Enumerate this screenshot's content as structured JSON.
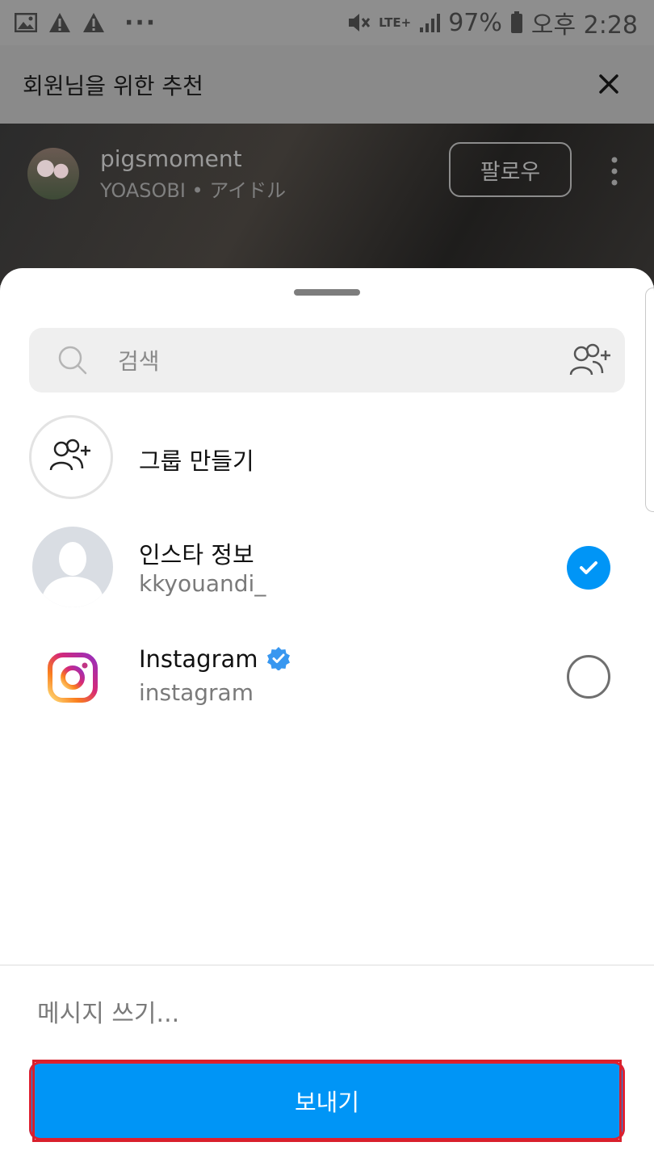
{
  "status_bar": {
    "battery": "97%",
    "time": "오후 2:28",
    "network": "LTE+",
    "dots": "···"
  },
  "header": {
    "title": "회원님을 위한 추천"
  },
  "background_post": {
    "username": "pigsmoment",
    "subtitle": "YOASOBI • アイドル",
    "follow_label": "팔로우"
  },
  "share_sheet": {
    "search_placeholder": "검색",
    "create_group_label": "그룹 만들기",
    "contacts": [
      {
        "name": "인스타 정보",
        "username": "kkyouandi_",
        "selected": true
      },
      {
        "name": "Instagram",
        "username": "instagram",
        "selected": false,
        "verified": true
      }
    ],
    "message_placeholder": "메시지 쓰기...",
    "send_label": "보내기"
  },
  "colors": {
    "accent": "#0095f6",
    "highlight_outline": "#d9202c"
  }
}
